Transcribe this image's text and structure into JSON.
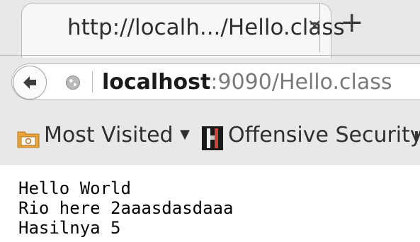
{
  "tab": {
    "title": "http://localh.../Hello.class",
    "close_glyph": "×",
    "new_tab_glyph": "+"
  },
  "navigation": {
    "back_icon": "back-arrow-icon",
    "identity_icon": "globe-icon",
    "url_host": "localhost",
    "url_rest": ":9090/Hello.class"
  },
  "bookmarks": {
    "most_visited": {
      "icon": "folder-icon",
      "label": "Most Visited",
      "dropdown_glyph": "▼"
    },
    "offensive_security": {
      "icon": "offsec-logo-icon",
      "label": "Offensive Security"
    }
  },
  "page": {
    "lines": [
      "Hello World",
      "Rio here 2aaasdasdaaa",
      "Hasilnya 5"
    ]
  },
  "colors": {
    "chrome_background": "#e8e8e7",
    "url_host": "#1b1b1b",
    "url_path": "#7a7a7a",
    "folder_icon": "#e8a53a"
  }
}
